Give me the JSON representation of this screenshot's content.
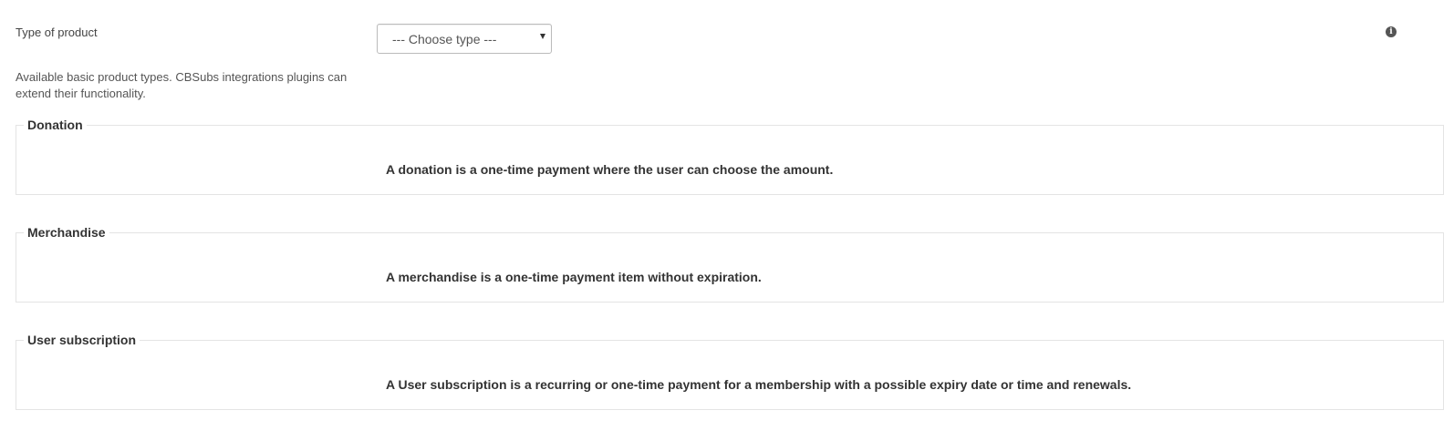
{
  "field": {
    "label": "Type of product",
    "select": {
      "value": "--- Choose type ---"
    },
    "help": "Available basic product types. CBSubs integrations plugins can extend their functionality.",
    "info_icon_glyph": "i"
  },
  "types": [
    {
      "title": "Donation",
      "description": "A donation is a one-time payment where the user can choose the amount."
    },
    {
      "title": "Merchandise",
      "description": "A merchandise is a one-time payment item without expiration."
    },
    {
      "title": "User subscription",
      "description": "A User subscription is a recurring or one-time payment for a membership with a possible expiry date or time and renewals."
    }
  ]
}
